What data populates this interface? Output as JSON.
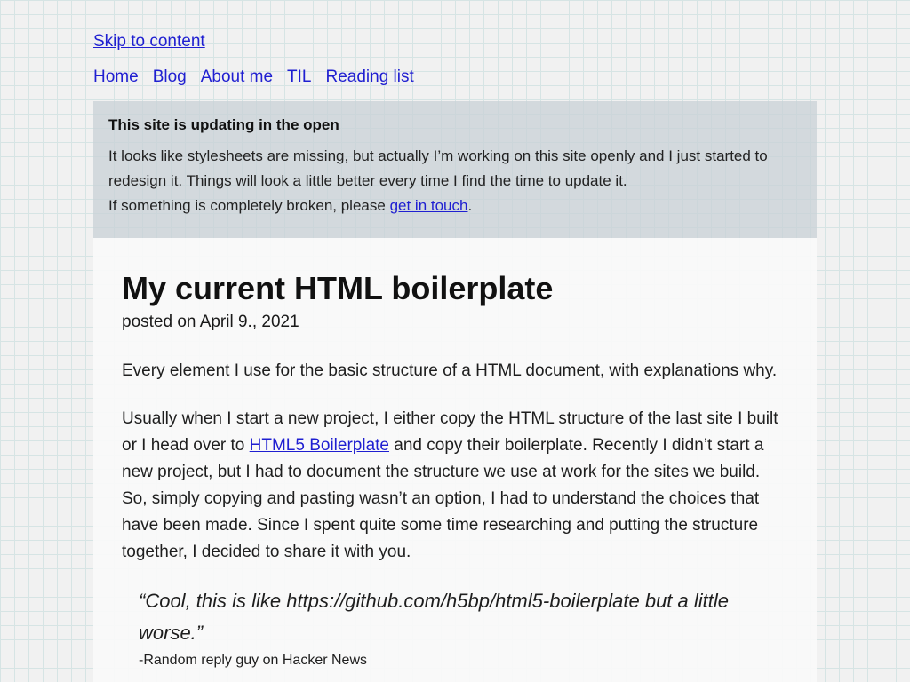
{
  "skip_link": "Skip to content",
  "nav": {
    "items": [
      "Home",
      "Blog",
      "About me",
      "TIL",
      "Reading list"
    ]
  },
  "notice": {
    "title": "This site is updating in the open",
    "line1": "It looks like stylesheets are missing, but actually I’m working on this site openly and I just started to redesign it. Things will look a little better every time I find the time to update it.",
    "line2_prefix": "If something is completely broken, please ",
    "line2_link": "get in touch",
    "line2_suffix": "."
  },
  "article": {
    "title": "My current HTML boilerplate",
    "posted": "posted on April 9., 2021",
    "intro": "Every element I use for the basic structure of a HTML document, with explanations why.",
    "para_prefix": "Usually when I start a new project, I either copy the HTML structure of the last site I built or I head over to ",
    "para_link": "HTML5 Boilerplate",
    "para_suffix": " and copy their boilerplate. Recently I didn’t start a new project, but I had to document the structure we use at work for the sites we build. So, simply copying and pasting wasn’t an option, I had to understand the choices that have been made. Since I spent quite some time researching and putting the structure together, I decided to share it with you.",
    "quote": "“Cool, this is like https://github.com/h5bp/html5-boilerplate but a little worse.”",
    "quote_cite": "-Random reply guy on Hacker News"
  }
}
